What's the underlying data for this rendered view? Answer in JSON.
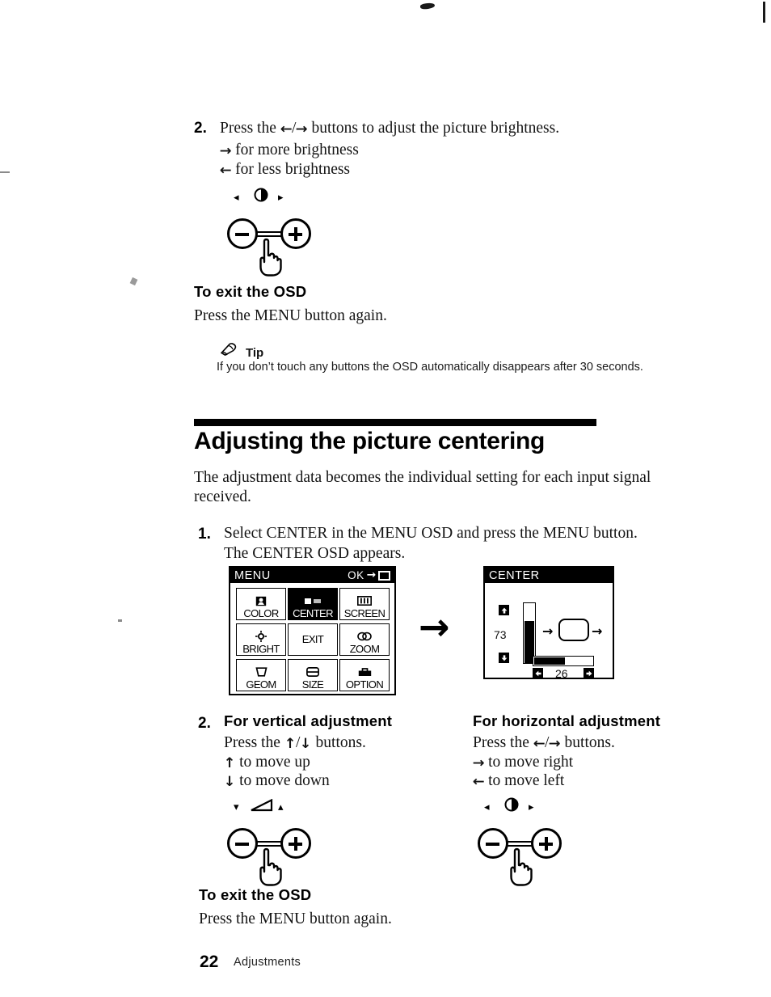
{
  "page": {
    "number": "22",
    "running_title": "Adjustments"
  },
  "brightness_step": {
    "number": "2.",
    "line1_pre": "Press the ",
    "line1_arrow_left": "←",
    "line1_slash": "/",
    "line1_arrow_right": "→",
    "line1_post": " buttons to adjust the picture brightness.",
    "line2_arrow": "→",
    "line2_text": " for more brightness",
    "line3_arrow": "←",
    "line3_text": " for less brightness"
  },
  "brightness_control": {
    "left_symbol": "◂",
    "center_symbol": "brightness-icon",
    "right_symbol": "▸",
    "minus_label": "−",
    "plus_label": "+",
    "hand_label": "pointing-hand"
  },
  "exit_osd_top": {
    "heading": "To exit the OSD",
    "body": "Press the MENU button again."
  },
  "tip": {
    "icon": "pencil-note-icon",
    "label": "Tip",
    "text": "If you don’t touch any buttons the OSD automatically disappears after 30 seconds."
  },
  "section": {
    "title": "Adjusting the picture centering",
    "intro_line1": "The adjustment data becomes the individual setting for each input signal",
    "intro_line2": "received."
  },
  "select_step": {
    "number": "1.",
    "line1": "Select CENTER in the MENU OSD and press the MENU button.",
    "line2": "The CENTER OSD appears."
  },
  "menu_osd": {
    "title": "MENU",
    "ok_label": "OK",
    "ok_arrow": "→",
    "ok_icon": "menu-button-icon",
    "cells": [
      {
        "label": "COLOR",
        "icon": "color-icon",
        "selected": false
      },
      {
        "label": "CENTER",
        "icon": "center-icon",
        "selected": true
      },
      {
        "label": "SCREEN",
        "icon": "screen-icon",
        "selected": false
      },
      {
        "label": "BRIGHT",
        "icon": "brightness-icon",
        "selected": false
      },
      {
        "label": "EXIT",
        "icon": "",
        "selected": false
      },
      {
        "label": "ZOOM",
        "icon": "zoom-icon",
        "selected": false
      },
      {
        "label": "GEOM",
        "icon": "geometry-icon",
        "selected": false
      },
      {
        "label": "SIZE",
        "icon": "size-icon",
        "selected": false
      },
      {
        "label": "OPTION",
        "icon": "option-icon",
        "selected": false
      }
    ]
  },
  "flow_arrow": "→",
  "center_osd": {
    "title": "CENTER",
    "vertical_value": "73",
    "vertical_up_arrow": "⬆",
    "vertical_down_arrow": "⬇",
    "horizontal_value": "26",
    "horizontal_left_arrow": "⬅",
    "horizontal_right_arrow": "➡",
    "pic_left_arrow": "→",
    "pic_right_arrow": "→"
  },
  "adjust_step": {
    "number": "2."
  },
  "vertical_adjustment": {
    "heading": "For vertical adjustment",
    "line1_pre": "Press the ",
    "line1_up": "↑",
    "line1_slash": "/",
    "line1_down": "↓",
    "line1_post": " buttons.",
    "line2_arrow": "↑",
    "line2_text": " to move up",
    "line3_arrow": "↓",
    "line3_text": " to move down",
    "control": {
      "left_symbol": "▾",
      "center_symbol": "wedge-icon",
      "right_symbol": "▴",
      "minus_label": "−",
      "plus_label": "+"
    }
  },
  "horizontal_adjustment": {
    "heading": "For horizontal adjustment",
    "line1_pre": "Press the ",
    "line1_left": "←",
    "line1_slash": "/",
    "line1_right": "→",
    "line1_post": " buttons.",
    "line2_arrow": "→",
    "line2_text": " to move right",
    "line3_arrow": "←",
    "line3_text": " to move left",
    "control": {
      "left_symbol": "◂",
      "center_symbol": "brightness-icon",
      "right_symbol": "▸",
      "minus_label": "−",
      "plus_label": "+"
    }
  },
  "exit_osd_bottom": {
    "heading": "To exit the OSD",
    "body": "Press the MENU button again."
  }
}
